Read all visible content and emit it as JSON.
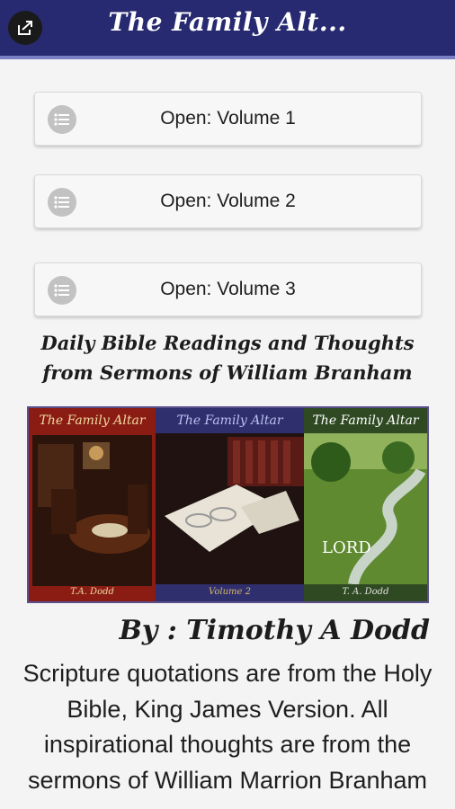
{
  "appbar": {
    "title": "The Family Alt...",
    "share_icon": "share-out-icon",
    "background": "#272a70"
  },
  "volumes": [
    {
      "label": "Open: Volume 1",
      "icon": "list-bullets-icon"
    },
    {
      "label": "Open: Volume 2",
      "icon": "list-bullets-icon"
    },
    {
      "label": "Open: Volume 3",
      "icon": "list-bullets-icon"
    }
  ],
  "subtitle": "Daily Bible Readings and Thoughts from Sermons of William Branham",
  "covers": [
    {
      "title": "The Family Altar",
      "footer": "T.A. Dodd"
    },
    {
      "title": "The Family Altar",
      "footer": "Volume 2"
    },
    {
      "title": "The Family Altar",
      "footer": "T. A. Dodd",
      "overlay": "LORD"
    }
  ],
  "author": "By : Timothy A Dodd",
  "body": "Scripture quotations are from the Holy Bible, King James Version. All inspirational thoughts are from the sermons of William Marrion Branham"
}
